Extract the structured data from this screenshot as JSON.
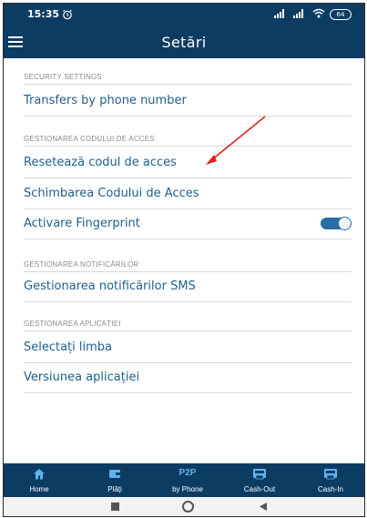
{
  "status_bar": {
    "time": "15:35",
    "battery": "64"
  },
  "app_bar": {
    "title": "Setări"
  },
  "sections": {
    "security": "SECURITY SETTINGS",
    "access_code": "GESTIONAREA CODULUI DE ACCES",
    "notifications": "GESTIONAREA NOTIFICĂRILOR",
    "app": "GESTIONAREA APLICAȚIEI"
  },
  "items": {
    "transfers_by_phone": "Transfers by phone number",
    "reset_code": "Resetează codul de acces",
    "change_code": "Schimbarea Codului de Acces",
    "fingerprint": "Activare Fingerprint",
    "sms_notifications": "Gestionarea notificărilor SMS",
    "language": "Selectați limba",
    "version": "Versiunea aplicației"
  },
  "fingerprint_toggle": {
    "state": "on"
  },
  "tabs": [
    {
      "label": "Home",
      "icon": "home-icon"
    },
    {
      "label": "Plăți",
      "icon": "wallet-icon"
    },
    {
      "label": "by Phone",
      "badge": "P2P"
    },
    {
      "label": "Cash-Out",
      "icon": "atm-icon"
    },
    {
      "label": "Cash-In",
      "icon": "atm-icon"
    }
  ],
  "colors": {
    "header": "#0d3c63",
    "link_text": "#1f5f8b",
    "toggle_on": "#2a6ea5",
    "annotation_arrow": "#e02020"
  }
}
